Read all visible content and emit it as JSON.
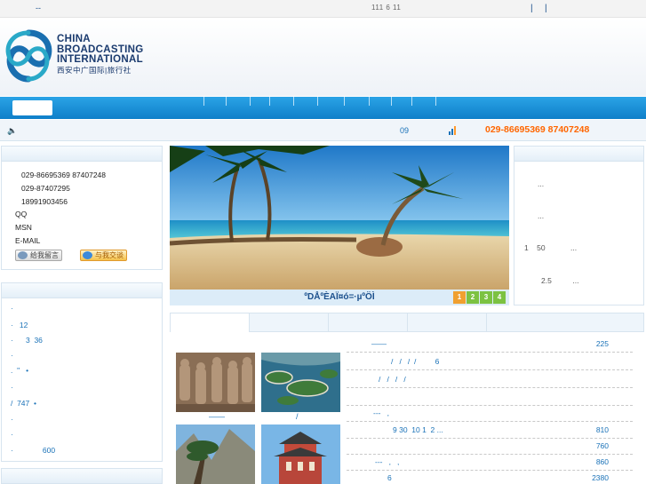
{
  "topbar": {
    "left_text": "--",
    "center_text": "111 6 11",
    "separator": "|"
  },
  "logo": {
    "line1": "CHINA",
    "line2": "BROADCASTING",
    "line3": "INTERNATIONAL",
    "line4": "西安中广国际|旅行社"
  },
  "infobar": {
    "speaker_icon": "speaker-icon",
    "date_text": "09",
    "signal_icon": "signal-bars-icon",
    "phone": "029-86695369 87407248"
  },
  "contact": {
    "phones": [
      "029-86695369 87407248",
      "029-87407295",
      "18991903456"
    ],
    "qq_label": "QQ",
    "msn_label": "MSN",
    "email_label": "E-MAIL",
    "leave_message": "给我留言",
    "chat": "与我交谈"
  },
  "left_list": [
    "·",
    "·   12",
    "·      3  36",
    "·",
    ".  \"   •",
    "·",
    "/  747  •",
    "·",
    "·",
    "·              600",
    "·"
  ],
  "banner": {
    "caption": "ºDÅºÈAÏ¤ó=·µºÖÌ",
    "pages": [
      "1",
      "2",
      "3",
      "4"
    ],
    "active_page_color": "#f0a030",
    "page_color": "#7cc242"
  },
  "right_list": [
    "...",
    "...",
    "1    50            ...",
    "2.5          ..."
  ],
  "bottom_thumbs": {
    "caption_left": "——",
    "caption_right": "/"
  },
  "routes": [
    {
      "title": "——",
      "price": "225"
    },
    {
      "title": "/   /   /  /         6",
      "price": ""
    },
    {
      "title": "/   /   /   /",
      "price": ""
    },
    {
      "title": "",
      "price": ""
    },
    {
      "title": "---   ,",
      "price": ""
    },
    {
      "title": "9 30  10 1  2 ...",
      "price": "810"
    },
    {
      "title": "",
      "price": "760"
    },
    {
      "title": "---   ,   ,",
      "price": "860"
    },
    {
      "title": "6",
      "price": "2380"
    }
  ]
}
